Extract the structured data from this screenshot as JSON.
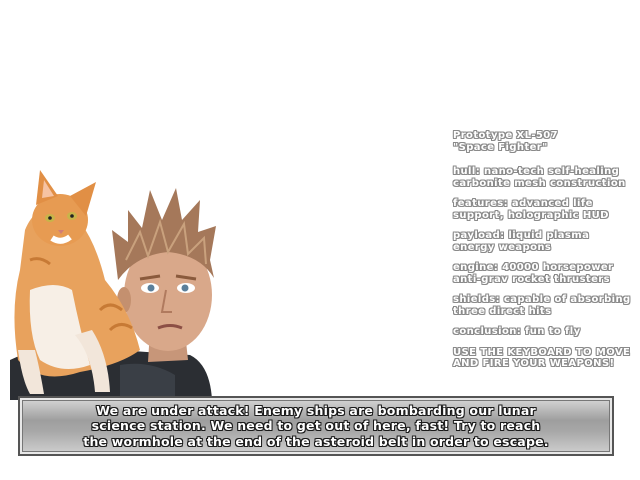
{
  "specs": [
    {
      "lines": [
        "Prototype XL-507",
        "\"Space Fighter\""
      ]
    },
    {
      "lines": [
        "hull: nano-tech self-healing",
        "carbonite mesh construction"
      ]
    },
    {
      "lines": [
        "features: advanced life",
        "support, holographic HUD"
      ]
    },
    {
      "lines": [
        "payload: liquid plasma",
        "energy weapons"
      ]
    },
    {
      "lines": [
        "engine: 40000 horsepower",
        "anti-grav rocket thrusters"
      ]
    },
    {
      "lines": [
        "shields: capable of absorbing",
        "three direct hits"
      ]
    },
    {
      "lines": [
        "conclusion: fun to fly"
      ]
    },
    {
      "lines": [
        "USE THE KEYBOARD TO MOVE",
        "AND FIRE YOUR WEAPONS!"
      ]
    }
  ],
  "dialog": {
    "lines": [
      "We are under attack! Enemy ships are bombarding our lunar",
      "science station. We need to get out of here, fast!  Try to reach",
      "the wormhole at the end of the asteroid belt in order to escape."
    ]
  },
  "portrait": {
    "icons": [
      "cat-illustration",
      "pilot-portrait"
    ]
  }
}
